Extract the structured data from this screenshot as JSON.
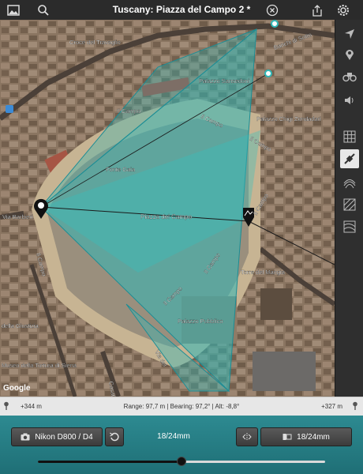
{
  "toolbar": {
    "title": "Tuscany: Piazza del Campo 2 *"
  },
  "map_labels": {
    "croce": "Croce del Travaglio",
    "banchi": "Banchi di Sotto",
    "sansedoni": "Palazzo Sansedoni",
    "chigi": "Palazzo Chigi Zondadari",
    "campo1": "Il Campo",
    "campo2": "Il Campo",
    "campo3": "Il Campo",
    "campo4": "Il Campo",
    "campo5": "Il Campo",
    "campo6": "Il Campo",
    "campo7": "Il Campo",
    "fonte": "Fonte Gaia",
    "piazza": "Piazza del Campo",
    "barbieri": "Via Barbieri",
    "mangia": "Torre del Mangia",
    "pubblico": "Palazzo Pubblico",
    "giustizia": "della Giustizia",
    "museo": "Museo della Tortura di Siena",
    "casato": "Casato",
    "via": "Via del",
    "google": "Google"
  },
  "info": {
    "left": "+344 m",
    "center": "Range: 97,7 m | Bearing: 97,2° | Alt: -8,8°",
    "right": "+327 m"
  },
  "bottom": {
    "camera": "Nikon D800 / D4",
    "lens_center": "18/24mm",
    "lens_button": "18/24mm"
  },
  "slider": {
    "value": 0.5
  },
  "colors": {
    "accent": "#2b8a91",
    "overlay": "#2fb8b8"
  }
}
